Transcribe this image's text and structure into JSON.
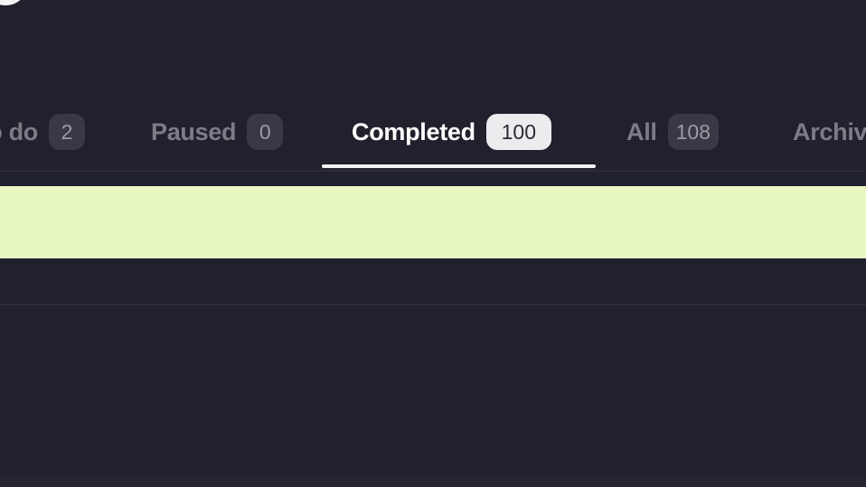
{
  "tabs": [
    {
      "label": "To do",
      "count": "2",
      "active": false
    },
    {
      "label": "Paused",
      "count": "0",
      "active": false
    },
    {
      "label": "Completed",
      "count": "100",
      "active": true
    },
    {
      "label": "All",
      "count": "108",
      "active": false
    },
    {
      "label": "Archived",
      "count": "",
      "active": false
    }
  ],
  "colors": {
    "background": "#21212d",
    "highlight": "#e7f8c1",
    "active_tab": "#ffffff",
    "inactive_tab": "#7c7c86"
  }
}
